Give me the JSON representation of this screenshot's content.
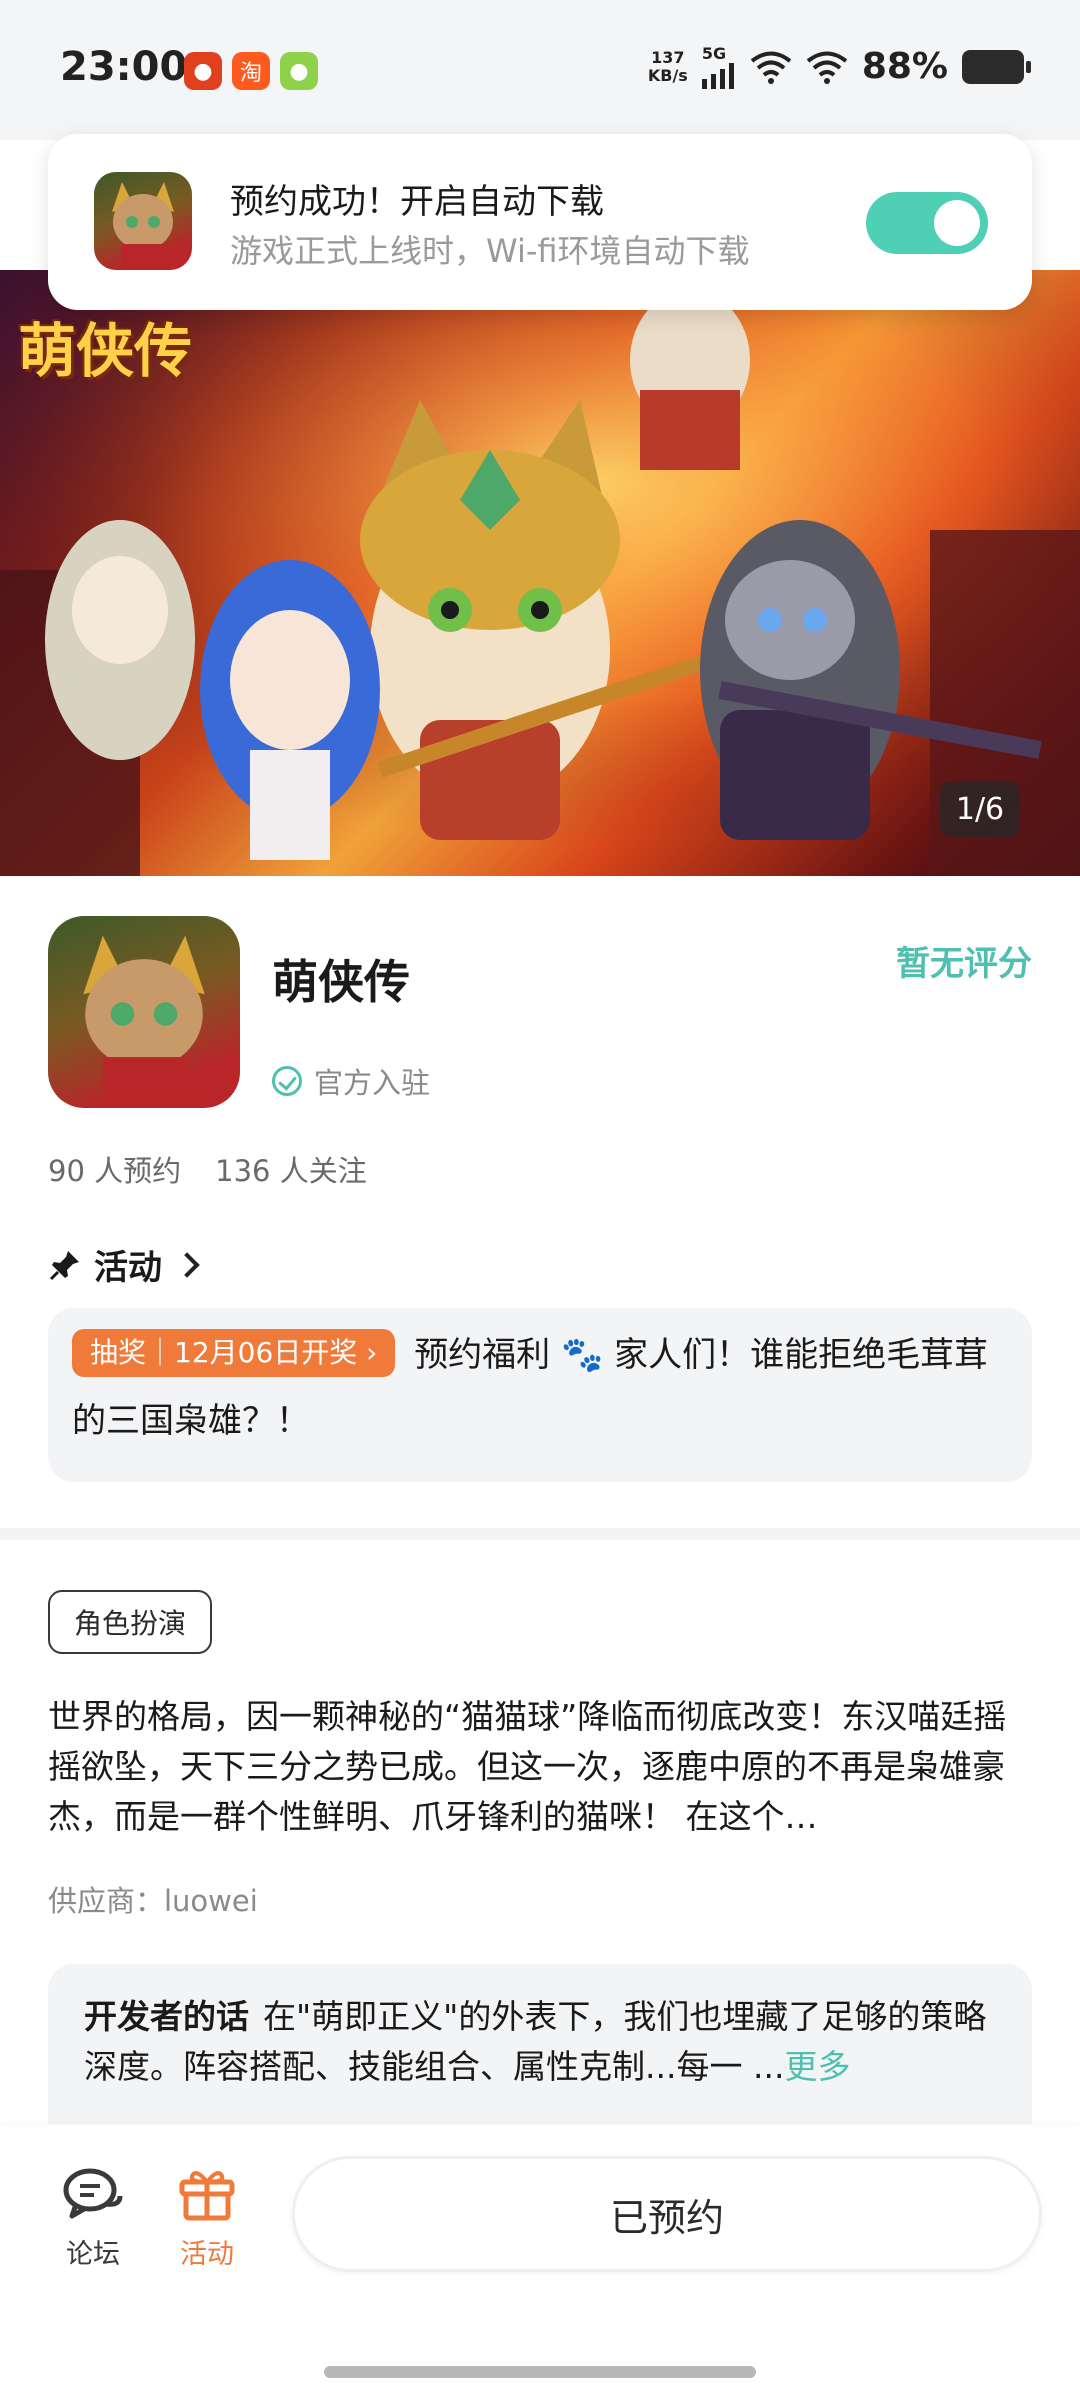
{
  "status_bar": {
    "time": "23:00",
    "speed_top": "137",
    "speed_unit": "KB/s",
    "network": "5G",
    "battery": "88%",
    "icons": [
      "notification-app-icon",
      "taobao-app-icon",
      "green-app-icon",
      "signal-icon",
      "wifi-icon",
      "wifi-icon",
      "battery-icon"
    ]
  },
  "toast": {
    "title": "预约成功！开启自动下载",
    "subtitle": "游戏正式上线时，Wi-fi环境自动下载",
    "toggle_on": true
  },
  "banner": {
    "logo_text": "萌侠传",
    "counter": "1/6"
  },
  "game": {
    "title": "萌侠传",
    "rating": "暂无评分",
    "official": "官方入驻",
    "reservations": "90 人预约",
    "followers": "136 人关注"
  },
  "activity": {
    "heading": "活动",
    "tag": "抽奖｜12月06日开奖",
    "text_before_icon": "预约福利",
    "text_after_icon": "家人们！谁能拒绝毛茸茸的三国枭雄？！"
  },
  "details": {
    "genre": "角色扮演",
    "description": "世界的格局，因一颗神秘的“猫猫球”降临而彻底改变！东汉喵廷摇摇欲坠，天下三分之势已成。但这一次，逐鹿中原的不再是枭雄豪杰，而是一群个性鲜明、爪牙锋利的猫咪！ 在这个…",
    "supplier": "供应商：luowei"
  },
  "developer": {
    "label": "开发者的话",
    "text": "在\"萌即正义\"的外表下，我们也埋藏了足够的策略深度。阵容搭配、技能组合、属性克制...每一 ...",
    "more": "更多"
  },
  "bottom_bar": {
    "forum": "论坛",
    "activity": "活动",
    "cta": "已预约"
  },
  "colors": {
    "accent_teal": "#4fbfb0",
    "accent_orange": "#f07a3a",
    "toggle_on": "#4fcfb4"
  }
}
